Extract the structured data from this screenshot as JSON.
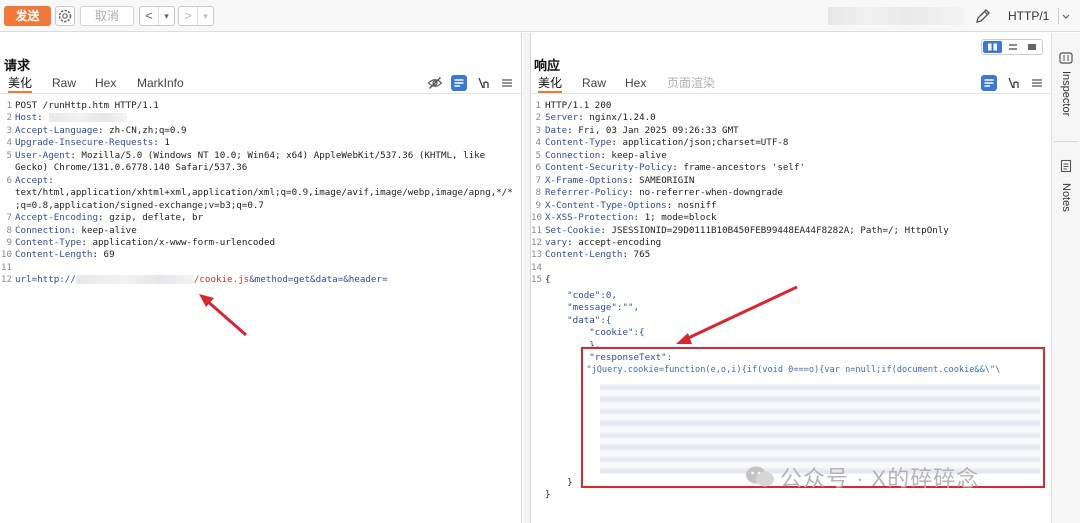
{
  "toolbar": {
    "send_label": "发送",
    "cancel_label": "取消",
    "back": "<",
    "back_menu": "▾",
    "forward": ">",
    "forward_menu": "▾",
    "http_version": "HTTP/1"
  },
  "request": {
    "title": "请求",
    "tabs": [
      "美化",
      "Raw",
      "Hex",
      "MarkInfo"
    ],
    "lines": [
      {
        "n": "1",
        "text": "POST /runHttp.htm HTTP/1.1"
      },
      {
        "n": "2",
        "key": "Host",
        "value": ""
      },
      {
        "n": "3",
        "key": "Accept-Language",
        "value": " zh-CN,zh;q=0.9"
      },
      {
        "n": "4",
        "key": "Upgrade-Insecure-Requests",
        "value": " 1"
      },
      {
        "n": "5",
        "key": "User-Agent",
        "value": " Mozilla/5.0 (Windows NT 10.0; Win64; x64) AppleWebKit/537.36 (KHTML, like"
      },
      {
        "n": "",
        "text": "Gecko) Chrome/131.0.6778.140 Safari/537.36"
      },
      {
        "n": "6",
        "key": "Accept",
        "value": ""
      },
      {
        "n": "",
        "text": "text/html,application/xhtml+xml,application/xml;q=0.9,image/avif,image/webp,image/apng,*/*"
      },
      {
        "n": "",
        "text": ";q=0.8,application/signed-exchange;v=b3;q=0.7"
      },
      {
        "n": "7",
        "key": "Accept-Encoding",
        "value": " gzip, deflate, br"
      },
      {
        "n": "8",
        "key": "Connection",
        "value": " keep-alive"
      },
      {
        "n": "9",
        "key": "Content-Type",
        "value": " application/x-www-form-urlencoded"
      },
      {
        "n": "10",
        "key": "Content-Length",
        "value": " 69"
      },
      {
        "n": "11",
        "text": ""
      }
    ],
    "body_line_no": "12",
    "body_prefix": "url=http://",
    "body_suffix": "/cookie.js",
    "body_params": "&method=get&data=&header="
  },
  "response": {
    "title": "响应",
    "tabs": [
      "美化",
      "Raw",
      "Hex",
      "页面渲染"
    ],
    "lines": [
      {
        "n": "1",
        "text": "HTTP/1.1 200"
      },
      {
        "n": "2",
        "key": "Server",
        "value": " nginx/1.24.0"
      },
      {
        "n": "3",
        "key": "Date",
        "value": " Fri, 03 Jan 2025 09:26:33 GMT"
      },
      {
        "n": "4",
        "key": "Content-Type",
        "value": " application/json;charset=UTF-8"
      },
      {
        "n": "5",
        "key": "Connection",
        "value": " keep-alive"
      },
      {
        "n": "6",
        "key": "Content-Security-Policy",
        "value": " frame-ancestors 'self'"
      },
      {
        "n": "7",
        "key": "X-Frame-Options",
        "value": " SAMEORIGIN"
      },
      {
        "n": "8",
        "key": "Referrer-Policy",
        "value": " no-referrer-when-downgrade"
      },
      {
        "n": "9",
        "key": "X-Content-Type-Options",
        "value": " nosniff"
      },
      {
        "n": "10",
        "key": "X-XSS-Protection",
        "value": " 1; mode=block"
      },
      {
        "n": "11",
        "key": "Set-Cookie",
        "value": " JSESSIONID=29D0111B10B450FEB99448EA44F8282A; Path=/; HttpOnly"
      },
      {
        "n": "12",
        "key": "vary",
        "value": " accept-encoding"
      },
      {
        "n": "13",
        "key": "Content-Length",
        "value": " 765"
      },
      {
        "n": "14",
        "text": ""
      }
    ],
    "json_line_no": "15",
    "json_lines": [
      "{",
      "    \"code\":0,",
      "    \"message\":\"\",",
      "    \"data\":{",
      "        \"cookie\":{",
      "        },",
      "        \"responseText\":",
      "        \"jQuery.cookie=function(e,o,i){if(void 0===o){var n=null;if(document.cookie&&\\\"\\",
      "    }",
      "}"
    ]
  },
  "side_panel": {
    "inspector": "Inspector",
    "notes": "Notes"
  },
  "watermark": "公众号 · X的碎碎念",
  "colors": {
    "accent": "#f0793a",
    "key_blue": "#2c4f9e",
    "annotation_red": "#d7272f",
    "toggle_blue": "#3a79d6"
  }
}
